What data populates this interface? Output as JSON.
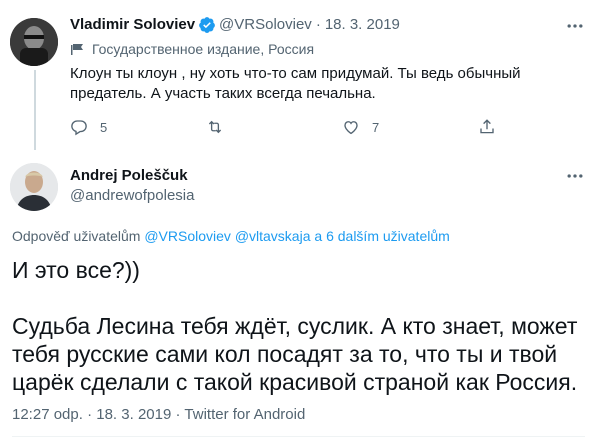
{
  "quoted_tweet": {
    "author_name": "Vladimir Soloviev",
    "handle": "@VRSoloviev",
    "separator": "·",
    "date": "18. 3. 2019",
    "verified": true,
    "account_label": "Государственное издание, Россия",
    "text": "Клоун ты клоун , ну хоть что-то сам придумай. Ты ведь обычный предатель. А участь таких всегда печальна.",
    "actions": {
      "reply_count": "5",
      "retweet_count": "",
      "like_count": "7"
    }
  },
  "main_tweet": {
    "author_name": "Andrej Poleščuk",
    "handle": "@andrewofpolesia",
    "replying_prefix": "Odpověď uživatelům",
    "replying_user_1": "@VRSoloviev",
    "replying_user_2": "@vltavskaja",
    "replying_more": "a 6 dalším uživatelům",
    "paragraph_1": "И это все?))",
    "paragraph_2": "Судьба Лесина тебя ждёт, суслик. А кто знает, может тебя русские сами кол посадят за то, что ты и твой царёк сделали с такой красивой страной как Россия.",
    "time": "12:27 odp.",
    "separator": "·",
    "date": "18. 3. 2019",
    "separator_2": "·",
    "source": "Twitter for Android"
  },
  "colors": {
    "accent": "#1d9bf0",
    "secondary_text": "#536471",
    "primary_text": "#0f1419",
    "thread_line": "#cfd9de"
  }
}
